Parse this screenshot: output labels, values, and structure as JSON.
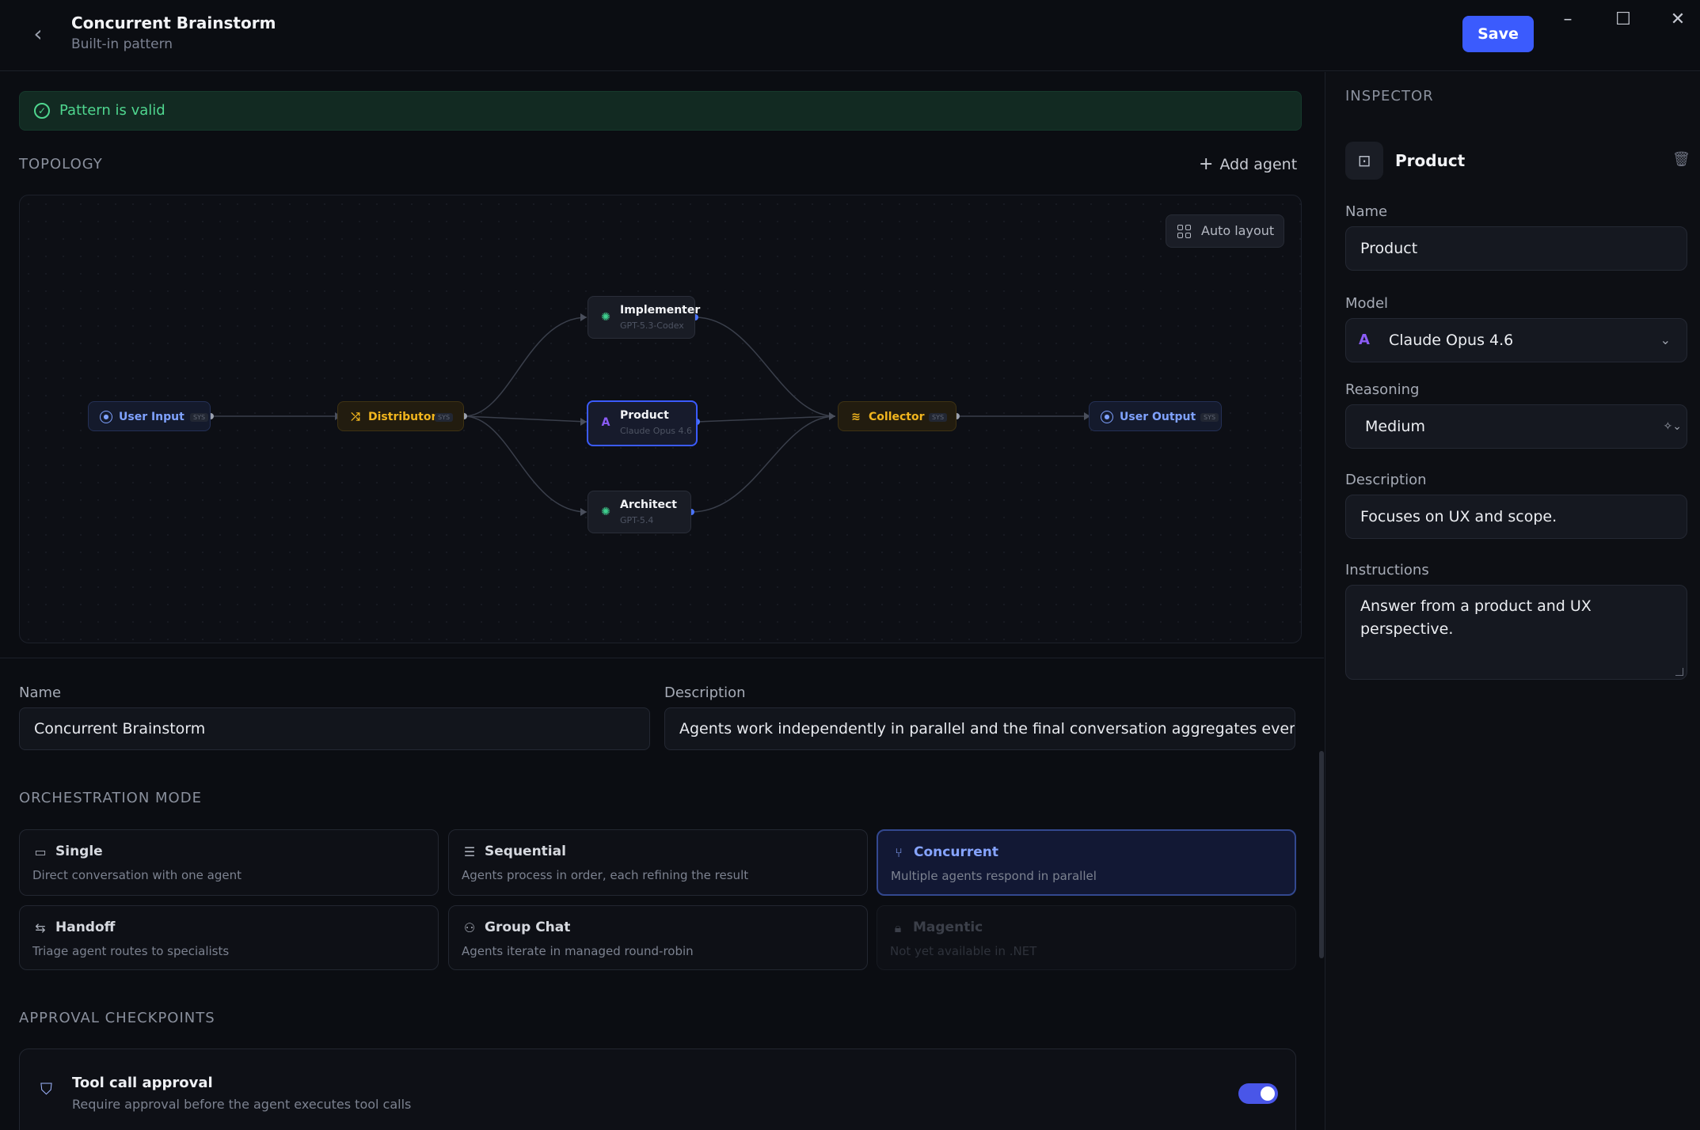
{
  "header": {
    "title": "Concurrent Brainstorm",
    "subtitle": "Built-in pattern",
    "save_label": "Save"
  },
  "status": {
    "message": "Pattern is valid"
  },
  "topology": {
    "label": "TOPOLOGY",
    "add_agent_label": "Add agent",
    "auto_layout_label": "Auto layout",
    "sys_tag": "SYS",
    "nodes": {
      "user_input": "User Input",
      "distributor": "Distributor",
      "implementer": {
        "name": "Implementer",
        "model": "GPT-5.3-Codex"
      },
      "product": {
        "name": "Product",
        "model": "Claude Opus 4.6"
      },
      "architect": {
        "name": "Architect",
        "model": "GPT-5.4"
      },
      "collector": "Collector",
      "user_output": "User Output"
    }
  },
  "pattern": {
    "name_label": "Name",
    "name_value": "Concurrent Brainstorm",
    "description_label": "Description",
    "description_value": "Agents work independently in parallel and the final conversation aggregates every re"
  },
  "orchestration": {
    "label": "ORCHESTRATION MODE",
    "modes": [
      {
        "title": "Single",
        "desc": "Direct conversation with one agent",
        "icon": "chat-icon",
        "state": "normal"
      },
      {
        "title": "Sequential",
        "desc": "Agents process in order, each refining the result",
        "icon": "list-icon",
        "state": "normal"
      },
      {
        "title": "Concurrent",
        "desc": "Multiple agents respond in parallel",
        "icon": "fork-icon",
        "state": "active"
      },
      {
        "title": "Handoff",
        "desc": "Triage agent routes to specialists",
        "icon": "swap-icon",
        "state": "normal"
      },
      {
        "title": "Group Chat",
        "desc": "Agents iterate in managed round-robin",
        "icon": "users-icon",
        "state": "normal"
      },
      {
        "title": "Magentic",
        "desc": "Not yet available in .NET",
        "icon": "lock-icon",
        "state": "disabled"
      }
    ]
  },
  "approval": {
    "label": "APPROVAL CHECKPOINTS",
    "title": "Tool call approval",
    "desc": "Require approval before the agent executes tool calls",
    "enabled": true
  },
  "inspector": {
    "title": "INSPECTOR",
    "agent_name": "Product",
    "name_label": "Name",
    "name_value": "Product",
    "model_label": "Model",
    "model_value": "Claude Opus 4.6",
    "reasoning_label": "Reasoning",
    "reasoning_value": "Medium",
    "description_label": "Description",
    "description_value": "Focuses on UX and scope.",
    "instructions_label": "Instructions",
    "instructions_value": "Answer from a product and UX perspective."
  },
  "colors": {
    "accent": "#3b5bfd",
    "valid": "#4fd68f",
    "system_node": "#7fa2ff",
    "router_node": "#f1b51e",
    "openai": "#3ecf8e",
    "anthropic": "#8b5cf6"
  }
}
